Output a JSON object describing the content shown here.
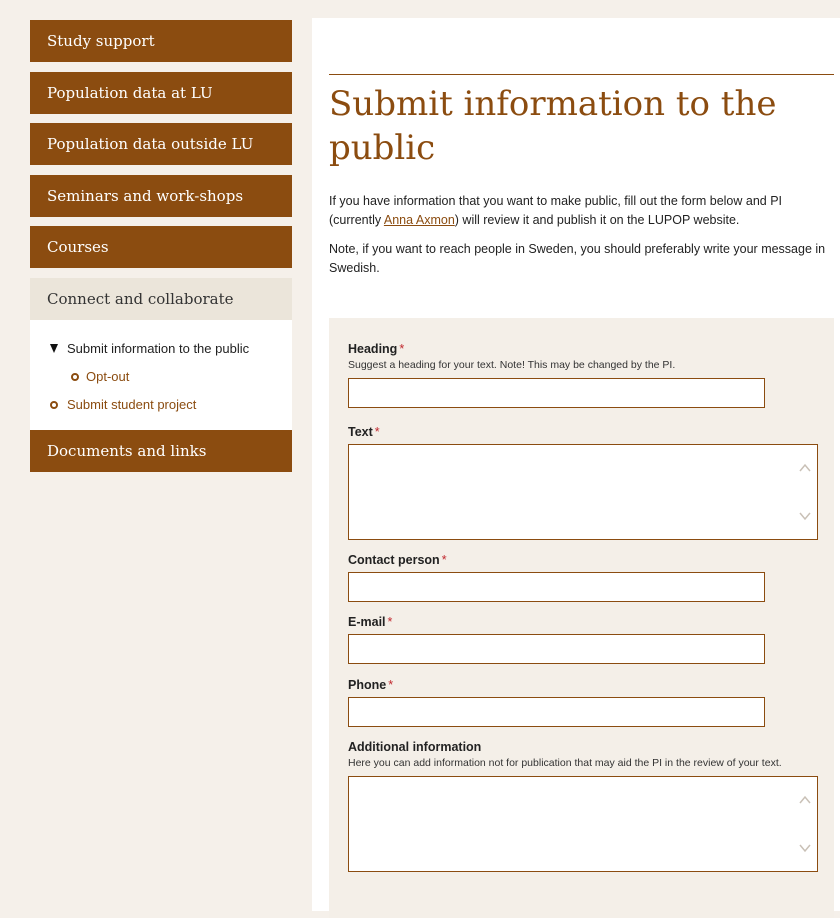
{
  "sidebar": {
    "items": [
      {
        "label": "Study support"
      },
      {
        "label": "Population data at LU"
      },
      {
        "label": "Population data outside LU"
      },
      {
        "label": "Seminars and work-shops"
      },
      {
        "label": "Courses"
      },
      {
        "label": "Connect and collaborate"
      },
      {
        "label": "Documents and links"
      }
    ],
    "subnav": [
      {
        "label": "Submit information to the public"
      },
      {
        "label": "Opt-out"
      },
      {
        "label": "Submit student project"
      }
    ]
  },
  "main": {
    "title": "Submit information to the public",
    "intro_1_before": "If you have information that you want to make public, fill out the form below and PI (currently ",
    "intro_1_link": "Anna Axmon",
    "intro_1_after": ") will review it and publish it on the LUPOP website.",
    "intro_2": "Note, if you want to reach people in Sweden, you should preferably write your message in Swedish."
  },
  "form": {
    "required_marker": "*",
    "heading": {
      "label": "Heading",
      "hint": "Suggest a heading for your text. Note! This may be changed by the PI.",
      "value": ""
    },
    "text": {
      "label": "Text",
      "value": ""
    },
    "contact": {
      "label": "Contact person",
      "value": ""
    },
    "email": {
      "label": "E-mail",
      "value": ""
    },
    "phone": {
      "label": "Phone",
      "value": ""
    },
    "additional": {
      "label": "Additional information",
      "hint": "Here you can add information not for publication that may aid the PI in the review of your text.",
      "value": ""
    }
  },
  "colors": {
    "brand": "#8b4c10",
    "active_nav_bg": "#ebe5da",
    "page_bg": "#f5f0ea",
    "required": "#c0272d"
  },
  "icons": {
    "expanded": "triangle-down-icon",
    "bullet": "ring-bullet-icon",
    "scroll_up": "chevron-up-icon",
    "scroll_down": "chevron-down-icon"
  }
}
